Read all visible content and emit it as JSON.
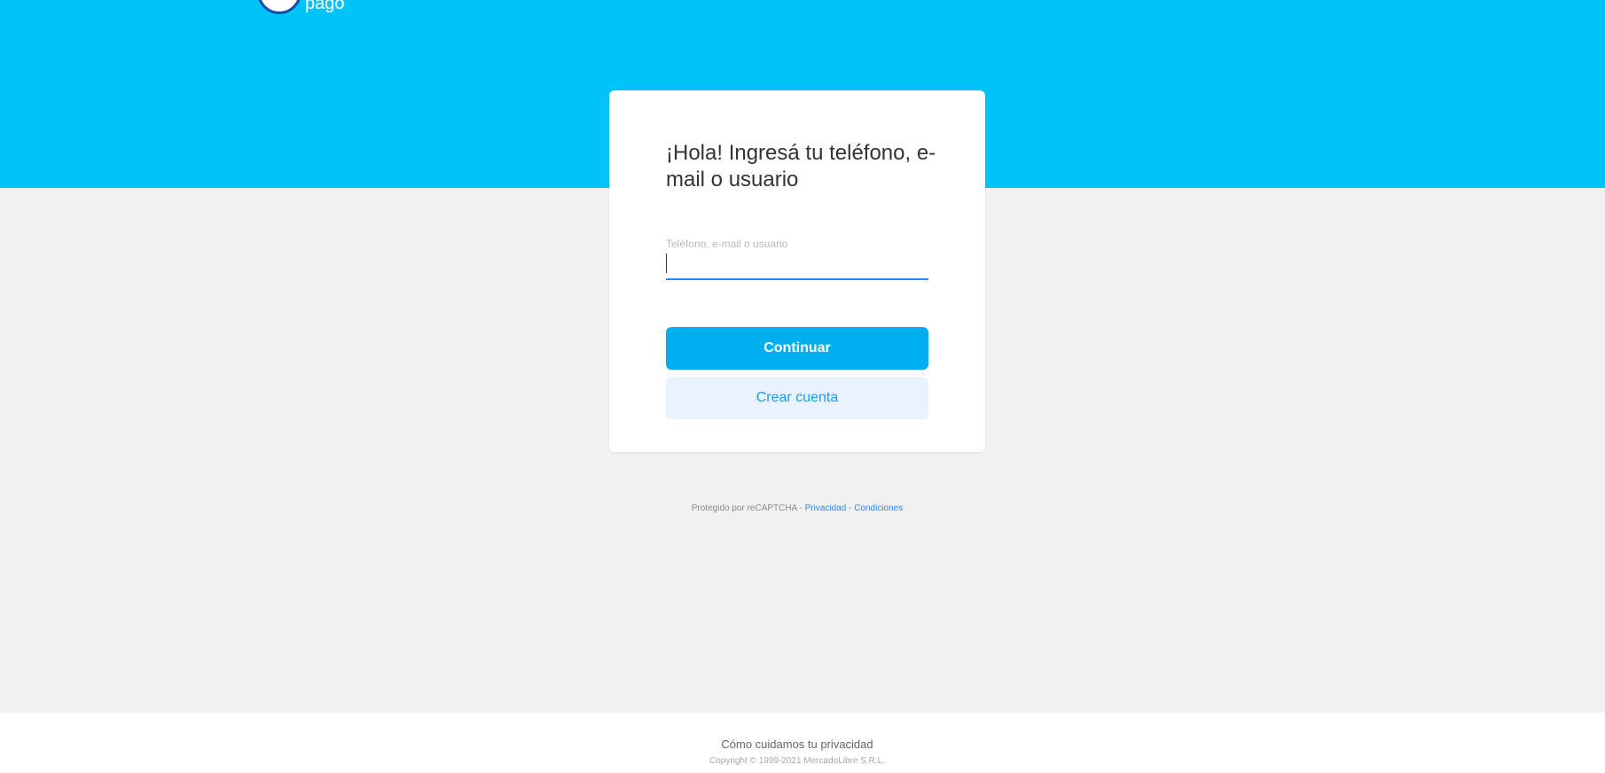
{
  "brand": {
    "logo_text": "pago",
    "colors": {
      "header_bg": "#00c3f7",
      "primary_button": "#00aeef",
      "secondary_button_bg": "#eaf3fd",
      "input_underline": "#3483fa",
      "page_bg": "#f1f1f1"
    }
  },
  "login": {
    "title": "¡Hola! Ingresá tu teléfono, e-mail o usuario",
    "field_label": "Teléfono, e-mail o usuario",
    "field_value": "",
    "continue_label": "Continuar",
    "create_account_label": "Crear cuenta"
  },
  "recaptcha": {
    "prefix": "Protegido por reCAPTCHA - ",
    "privacy_label": "Privacidad",
    "separator": " - ",
    "terms_label": "Condiciones"
  },
  "footer": {
    "privacy_link": "Cómo cuidamos tu privacidad",
    "copyright": "Copyright © 1999-2021 MercadoLibre S.R.L."
  }
}
